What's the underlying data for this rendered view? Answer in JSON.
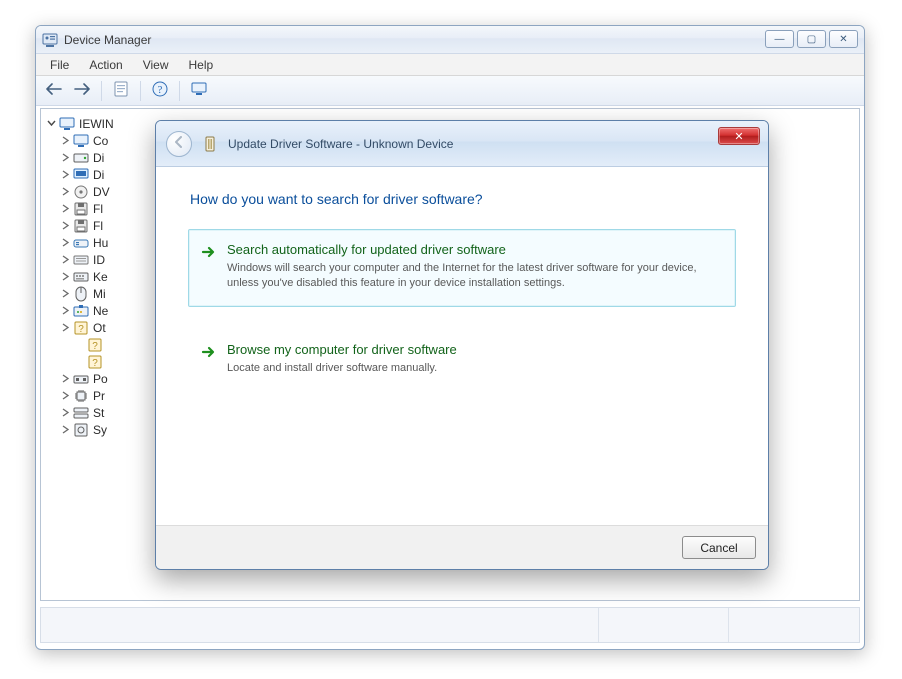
{
  "parent_window": {
    "title": "Device Manager",
    "menu": [
      "File",
      "Action",
      "View",
      "Help"
    ],
    "caption": {
      "minimize": "—",
      "maximize": "▢",
      "close": "✕"
    },
    "tree": {
      "root": "IEWIN",
      "items": [
        {
          "label": "Co",
          "icon": "monitor"
        },
        {
          "label": "Di",
          "icon": "drive"
        },
        {
          "label": "Di",
          "icon": "display-adapter"
        },
        {
          "label": "DV",
          "icon": "disc"
        },
        {
          "label": "Fl",
          "icon": "floppy"
        },
        {
          "label": "Fl",
          "icon": "floppy"
        },
        {
          "label": "Hu",
          "icon": "hid"
        },
        {
          "label": "ID",
          "icon": "ide"
        },
        {
          "label": "Ke",
          "icon": "keyboard"
        },
        {
          "label": "Mi",
          "icon": "mouse"
        },
        {
          "label": "Ne",
          "icon": "network"
        },
        {
          "label": "Ot",
          "icon": "other"
        },
        {
          "label": "Po",
          "icon": "ports"
        },
        {
          "label": "Pr",
          "icon": "processor"
        },
        {
          "label": "St",
          "icon": "storage"
        },
        {
          "label": "Sy",
          "icon": "system"
        }
      ]
    }
  },
  "dialog": {
    "title_prefix": "Update Driver Software - ",
    "device_name": "Unknown Device",
    "heading": "How do you want to search for driver software?",
    "options": [
      {
        "id": "search-auto",
        "title": "Search automatically for updated driver software",
        "desc": "Windows will search your computer and the Internet for the latest driver software for your device, unless you've disabled this feature in your device installation settings.",
        "selected": true
      },
      {
        "id": "browse-local",
        "title": "Browse my computer for driver software",
        "desc": "Locate and install driver software manually.",
        "selected": false
      }
    ],
    "buttons": {
      "cancel": "Cancel"
    },
    "close_glyph": "✕"
  }
}
